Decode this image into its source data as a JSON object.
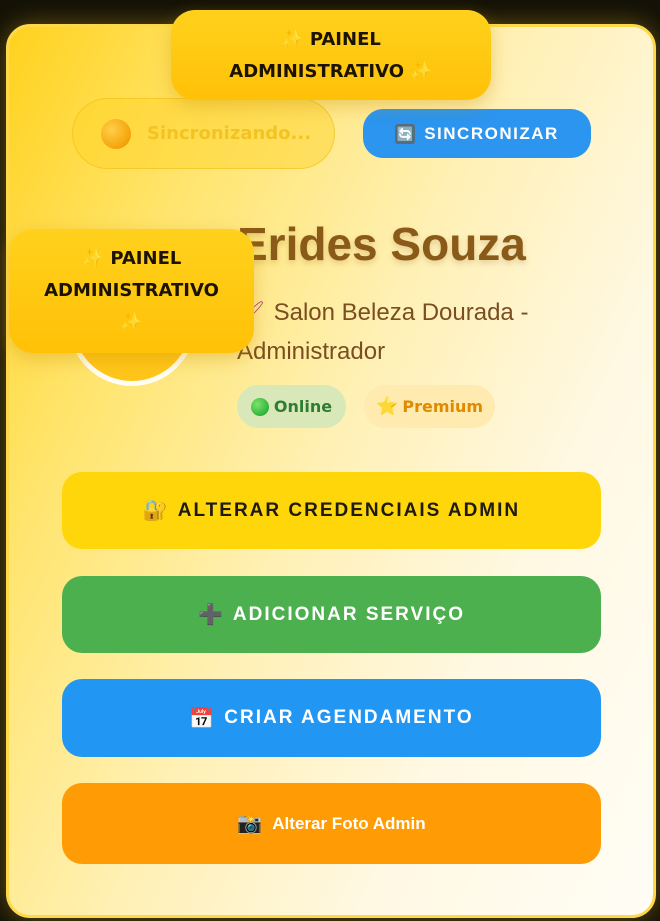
{
  "header_badge": {
    "line1": "✨ PAINEL",
    "line2": "ADMINISTRATIVO ✨"
  },
  "side_badge": {
    "line1": "✨ PAINEL",
    "line2": "ADMINISTRATIVO",
    "line3": "✨"
  },
  "sync": {
    "status_text": "Sincronizando...",
    "button_label": "SINCRONIZAR",
    "button_icon": "🔄"
  },
  "profile": {
    "name": "Erides Souza",
    "subtitle_icon": "🖌",
    "subtitle_line1": "Salon Beleza Dourada -",
    "subtitle_line2": "Administrador",
    "status_online": "Online",
    "status_premium": "Premium",
    "premium_icon": "⭐"
  },
  "actions": {
    "credentials": {
      "icon": "🔐",
      "label": "ALTERAR CREDENCIAIS ADMIN"
    },
    "add_service": {
      "icon": "➕",
      "label": "ADICIONAR SERVIÇO"
    },
    "create_booking": {
      "icon": "📅",
      "label": "CRIAR AGENDAMENTO"
    },
    "change_photo": {
      "icon": "📸",
      "label": "Alterar Foto Admin"
    }
  },
  "colors": {
    "accent_gold": "#ffd21e",
    "blue": "#2196f3",
    "green": "#4cb04f",
    "orange": "#ff9c05",
    "name_brown": "#8a5a18"
  }
}
